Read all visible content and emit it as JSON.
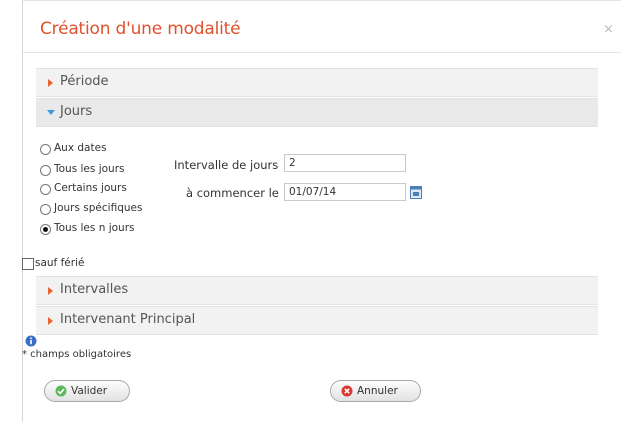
{
  "dialog": {
    "title": "Création d'une modalité",
    "close_label": "×"
  },
  "accordion": {
    "periode": "Période",
    "jours": "Jours",
    "intervalles": "Intervalles",
    "intervenant": "Intervenant Principal"
  },
  "radios": [
    {
      "label": "Aux dates",
      "checked": false
    },
    {
      "label": "Tous les jours",
      "checked": false
    },
    {
      "label": "Certains jours",
      "checked": false
    },
    {
      "label": "Jours spécifiques",
      "checked": false
    },
    {
      "label": "Tous les n jours",
      "checked": true
    }
  ],
  "interval": {
    "label": "Intervalle de jours",
    "value": "2"
  },
  "start": {
    "label": "à commencer le",
    "value": "01/07/14"
  },
  "holiday": {
    "label": "sauf férié",
    "checked": false
  },
  "required_note": "* champs obligatoires",
  "buttons": {
    "validate": "Valider",
    "cancel": "Annuler"
  },
  "colors": {
    "title": "#e0512c",
    "accent": "#3a9ad9",
    "triangle": "#e8652e"
  },
  "icons": {
    "close": "close-icon",
    "calendar": "calendar-icon",
    "info": "info-icon",
    "validate": "check-circle-icon",
    "cancel": "x-circle-icon"
  }
}
